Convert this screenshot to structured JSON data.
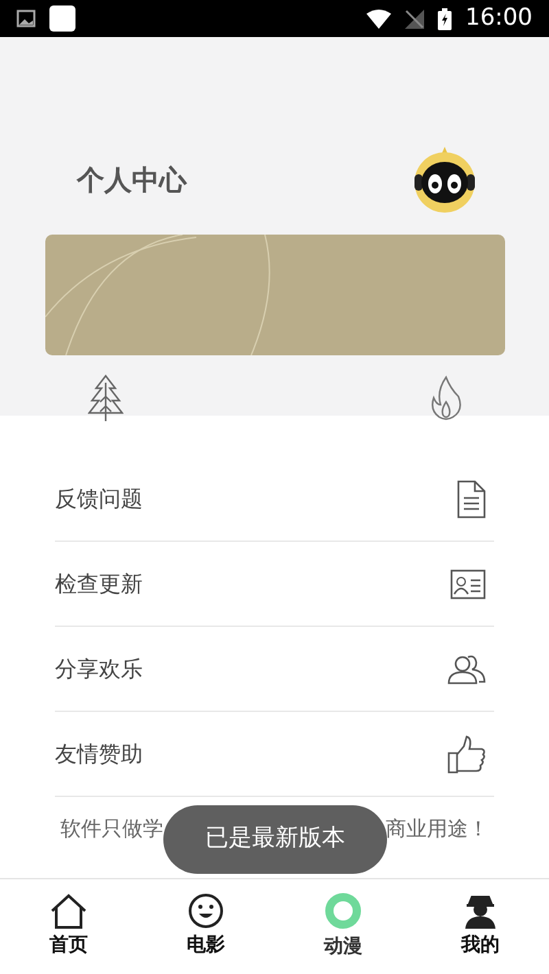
{
  "status_bar": {
    "time": "16:00"
  },
  "header": {
    "title": "个人中心"
  },
  "menu": [
    {
      "label": "反馈问题",
      "kind": "document"
    },
    {
      "label": "检查更新",
      "kind": "card"
    },
    {
      "label": "分享欢乐",
      "kind": "people"
    },
    {
      "label": "友情赞助",
      "kind": "thumb"
    }
  ],
  "footer_note": {
    "left": "软件只做学",
    "right": "商业用途！"
  },
  "toast": "已是最新版本",
  "tabs": [
    {
      "label": "首页",
      "kind": "home",
      "selected": false
    },
    {
      "label": "电影",
      "kind": "smile",
      "selected": false
    },
    {
      "label": "动漫",
      "kind": "ring",
      "selected": true
    },
    {
      "label": "我的",
      "kind": "person",
      "selected": false
    }
  ]
}
